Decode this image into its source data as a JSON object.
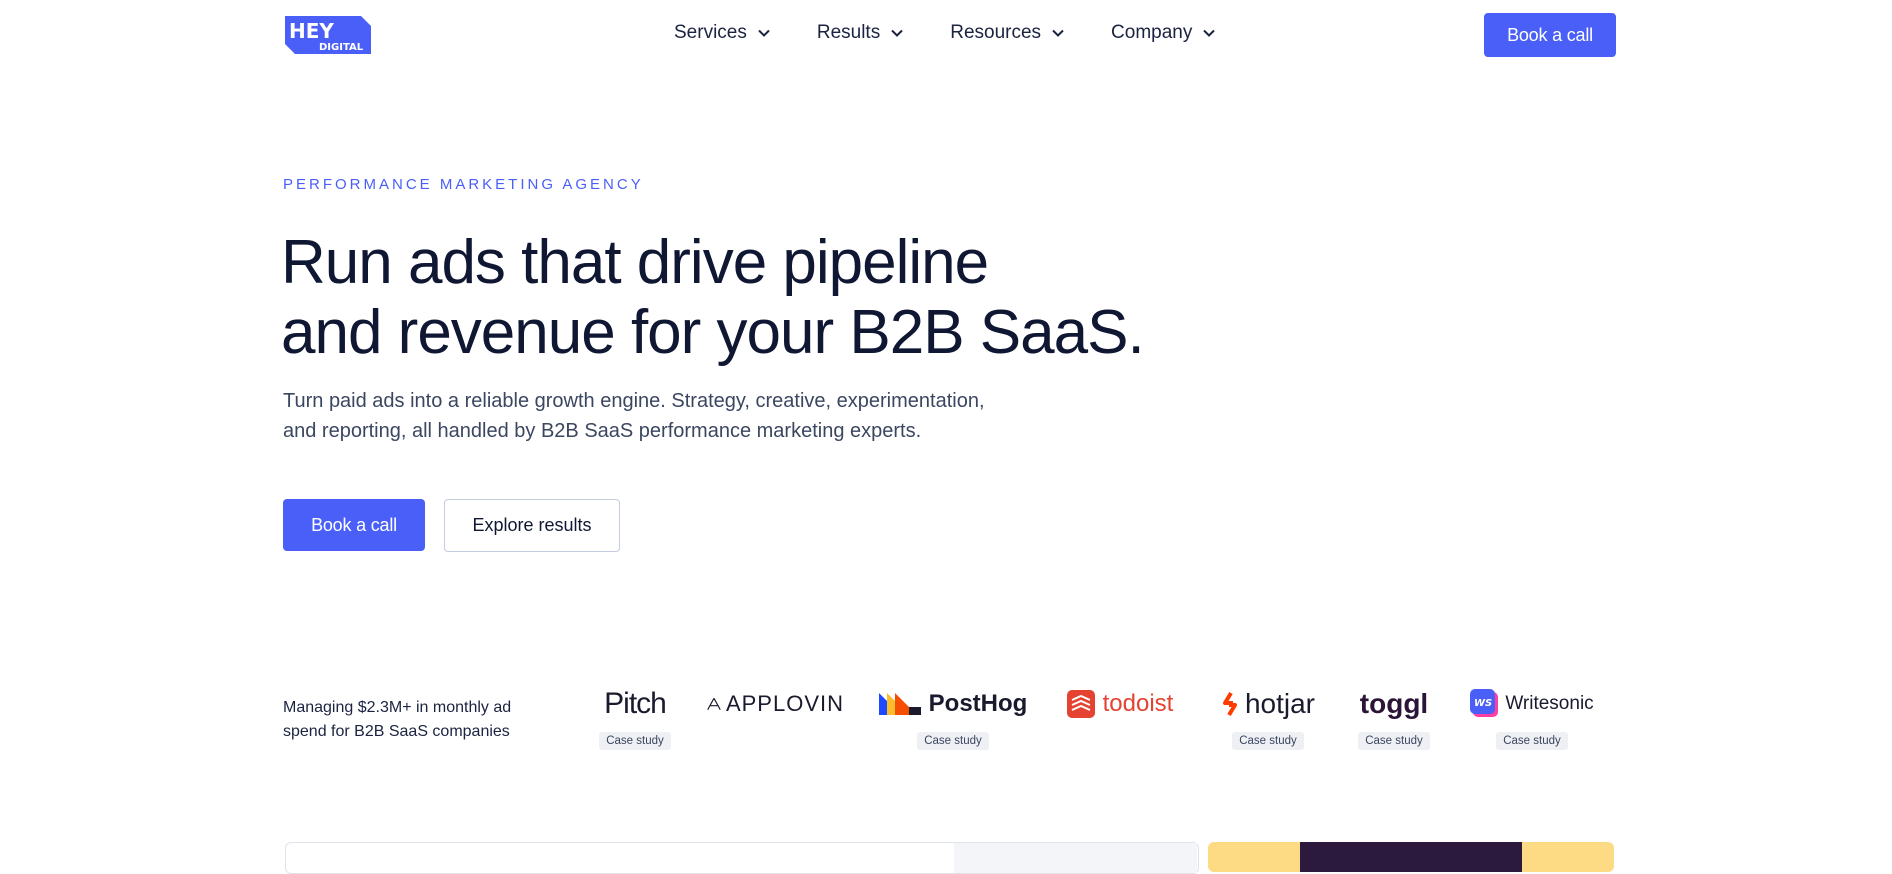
{
  "header": {
    "logo": {
      "line1": "HEY",
      "line2": "DIGITAL",
      "color": "#4a5ff7"
    },
    "nav": [
      {
        "label": "Services",
        "icon": "chevron-down-icon"
      },
      {
        "label": "Results",
        "icon": "chevron-down-icon"
      },
      {
        "label": "Resources",
        "icon": "chevron-down-icon"
      },
      {
        "label": "Company",
        "icon": "chevron-down-icon"
      }
    ],
    "cta_label": "Book a call"
  },
  "hero": {
    "eyebrow": "PERFORMANCE MARKETING AGENCY",
    "headline_line1": "Run ads that drive pipeline",
    "headline_line2": "and revenue for your B2B SaaS.",
    "subtext_line1": "Turn paid ads into a reliable growth engine. Strategy, creative, experimentation,",
    "subtext_line2": "and reporting, all handled by B2B SaaS performance marketing experts.",
    "primary_cta": "Book a call",
    "secondary_cta": "Explore results"
  },
  "clients": {
    "intro_line1": "Managing $2.3M+ in monthly ad",
    "intro_line2": "spend for B2B SaaS companies",
    "badge_label": "Case study",
    "logos": [
      {
        "name": "Pitch",
        "case_study": true
      },
      {
        "name": "APPLOVIN",
        "case_study": false
      },
      {
        "name": "PostHog",
        "case_study": true
      },
      {
        "name": "todoist",
        "case_study": false
      },
      {
        "name": "hotjar",
        "case_study": true
      },
      {
        "name": "toggl",
        "case_study": true
      },
      {
        "name": "Writesonic",
        "case_study": true
      }
    ]
  },
  "colors": {
    "accent": "#4a5ff7",
    "text": "#0f1733",
    "todoist": "#e44332",
    "hotjar": "#ff3c00",
    "toggl": "#2c1338",
    "card_yellow": "#fddb85"
  }
}
